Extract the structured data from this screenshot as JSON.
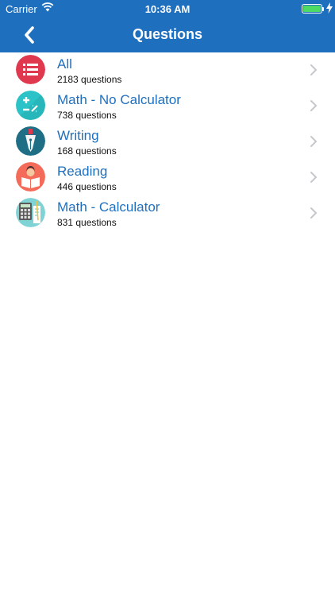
{
  "status": {
    "carrier": "Carrier",
    "time": "10:36 AM"
  },
  "nav": {
    "title": "Questions"
  },
  "items": [
    {
      "title": "All",
      "count": "2183 questions",
      "icon": "list-icon",
      "color": "#e0394f"
    },
    {
      "title": "Math - No Calculator",
      "count": "738 questions",
      "icon": "math-symbols-icon",
      "color": "#2bc3c7"
    },
    {
      "title": "Writing",
      "count": "168 questions",
      "icon": "pen-nib-icon",
      "color": "#1e6f86"
    },
    {
      "title": "Reading",
      "count": "446 questions",
      "icon": "reader-icon",
      "color": "#f46b5a"
    },
    {
      "title": "Math - Calculator",
      "count": "831 questions",
      "icon": "calculator-icon",
      "color": "#7fd3d5"
    }
  ],
  "colors": {
    "header": "#1f6fbf",
    "link": "#1f6fbf",
    "chevron": "#c7c7cc",
    "battery": "#4cd964"
  }
}
